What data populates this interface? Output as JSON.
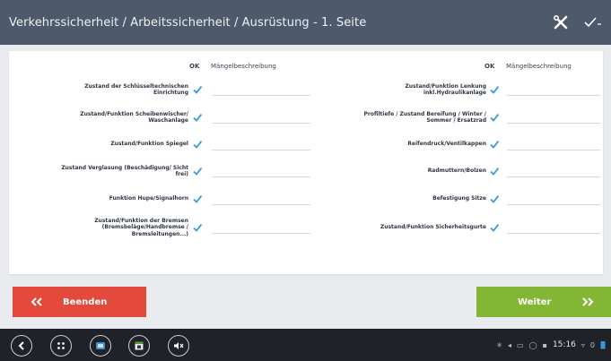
{
  "header": {
    "title": "Verkehrssicherheit / Arbeitssicherheit / Ausrüstung - 1. Seite",
    "tools_icon": "tools-icon",
    "check_icon": "check-icon"
  },
  "table": {
    "col_ok": "OK",
    "col_desc": "Mängelbeschreibung",
    "left_rows": [
      {
        "label": "Zustand der Schlüsseltechnischen Einrichtung",
        "checked": true,
        "note": ""
      },
      {
        "label": "Zustand/Funktion Scheibenwischer/ Waschanlage",
        "checked": true,
        "note": ""
      },
      {
        "label": "Zustand/Funktion Spiegel",
        "checked": true,
        "note": ""
      },
      {
        "label": "Zustand Verglasung (Beschädigung/ Sicht frei)",
        "checked": true,
        "note": ""
      },
      {
        "label": "Funktion Hupe/Signalhorn",
        "checked": true,
        "note": ""
      },
      {
        "label": "Zustand/Funktion der Bremsen (Bremsbeläge/Handbremse / Bremsleitungen...)",
        "checked": true,
        "note": ""
      }
    ],
    "right_rows": [
      {
        "label": "Zustand/Funktion Lenkung inkl.Hydraulikanlage",
        "checked": true,
        "note": ""
      },
      {
        "label": "Profiltiefe / Zustand Bereifung / Winter / Sommer / Ersatzrad",
        "checked": true,
        "note": ""
      },
      {
        "label": "Reifendruck/Ventilkappen",
        "checked": true,
        "note": ""
      },
      {
        "label": "Radmuttern/Bolzen",
        "checked": true,
        "note": ""
      },
      {
        "label": "Befestigung Sitze",
        "checked": true,
        "note": ""
      },
      {
        "label": "Zustand/Funktion Sicherheitsgurte",
        "checked": true,
        "note": ""
      }
    ]
  },
  "actions": {
    "end_label": "Beenden",
    "next_label": "Weiter"
  },
  "systembar": {
    "time": "15:16",
    "battery": "0"
  },
  "colors": {
    "titlebar": "#4e5a6b",
    "check": "#3a9ad9",
    "end": "#e34a3c",
    "next": "#84b636"
  }
}
